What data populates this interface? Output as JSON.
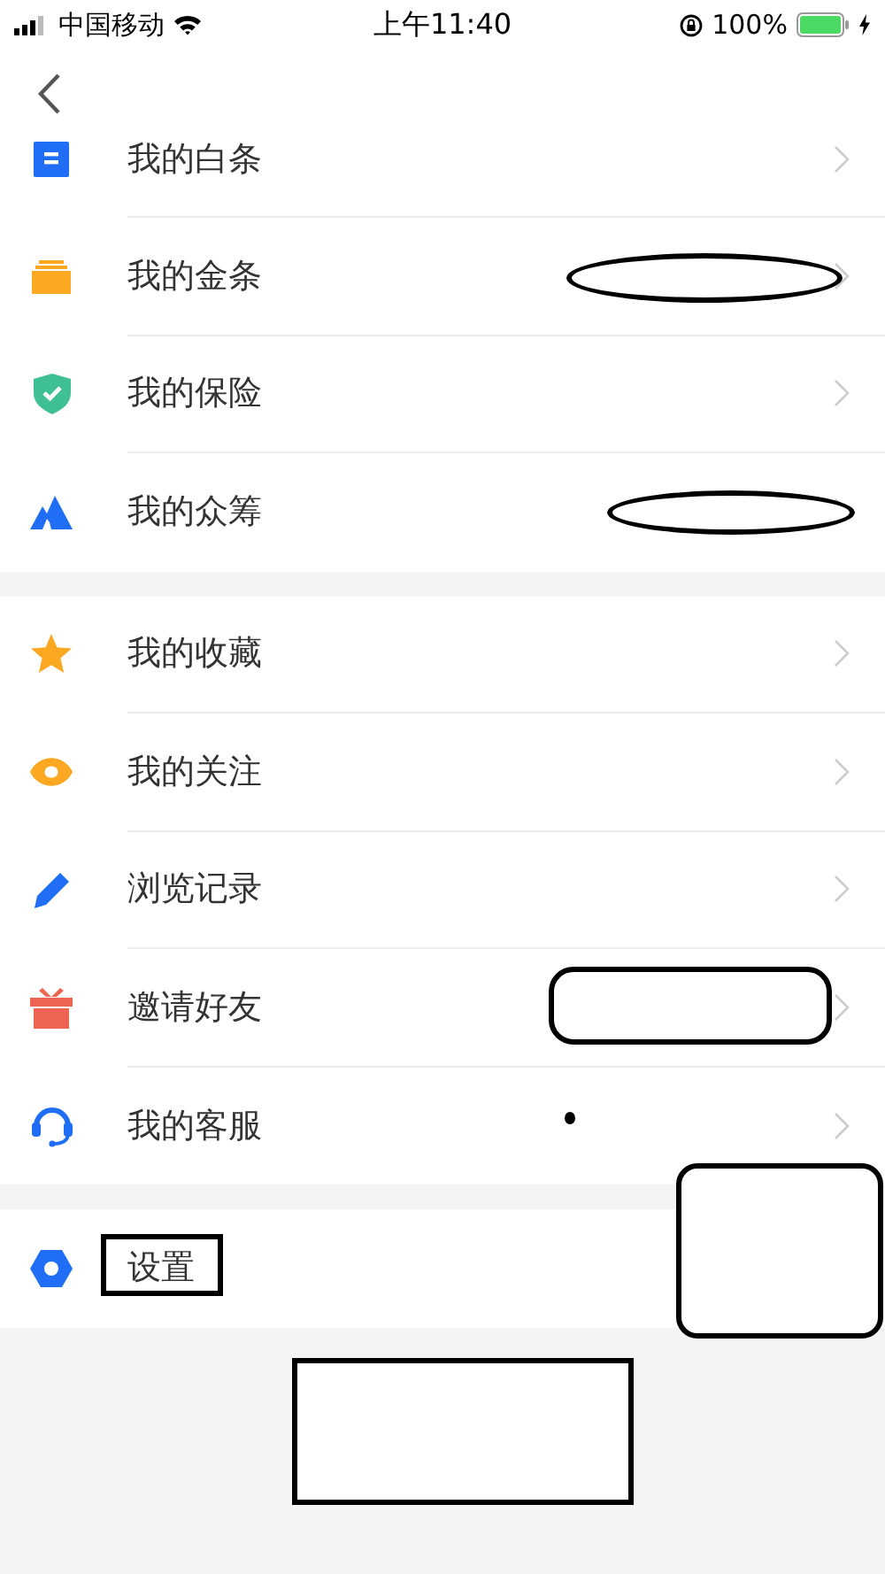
{
  "status_bar": {
    "carrier": "中国移动",
    "time": "上午11:40",
    "battery": "100%"
  },
  "groups": [
    {
      "items": [
        {
          "label": "我的白条"
        },
        {
          "label": "我的金条"
        },
        {
          "label": "我的保险"
        },
        {
          "label": "我的众筹"
        }
      ]
    },
    {
      "items": [
        {
          "label": "我的收藏"
        },
        {
          "label": "我的关注"
        },
        {
          "label": "浏览记录"
        },
        {
          "label": "邀请好友"
        },
        {
          "label": "我的客服"
        }
      ]
    },
    {
      "items": [
        {
          "label": "设置"
        }
      ]
    }
  ]
}
